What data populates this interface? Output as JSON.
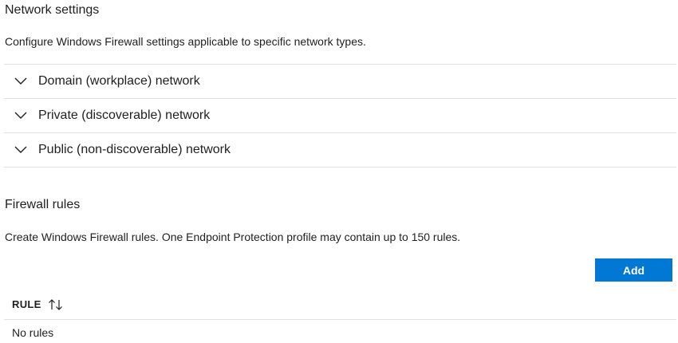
{
  "network_settings": {
    "title": "Network settings",
    "description": "Configure Windows Firewall settings applicable to specific network types.",
    "items": [
      {
        "label": "Domain (workplace) network",
        "icon": "chevron-down-icon"
      },
      {
        "label": "Private (discoverable) network",
        "icon": "chevron-down-icon"
      },
      {
        "label": "Public (non-discoverable) network",
        "icon": "chevron-down-icon"
      }
    ]
  },
  "firewall_rules": {
    "title": "Firewall rules",
    "description": "Create Windows Firewall rules. One Endpoint Protection profile may contain up to 150 rules.",
    "add_label": "Add",
    "table": {
      "columns": [
        {
          "label": "RULE",
          "icon": "sort-icon"
        }
      ],
      "empty_text": "No rules"
    }
  },
  "colors": {
    "accent": "#0078d4",
    "divider": "#e0e0e0",
    "text": "#1f1f1f"
  }
}
